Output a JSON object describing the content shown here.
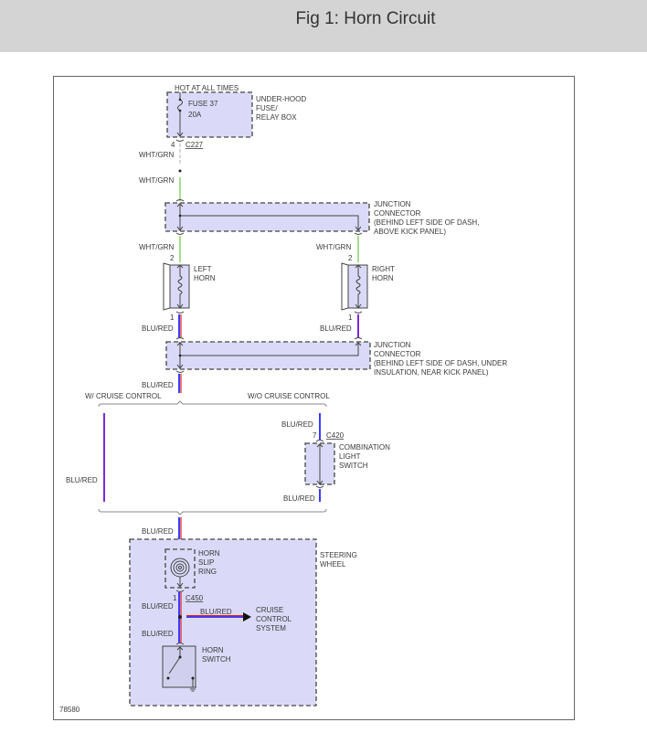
{
  "header": {
    "title": "Fig 1: Horn Circuit"
  },
  "diagram": {
    "hot_label": "HOT AT ALL TIMES",
    "fuse": {
      "name": "FUSE 37",
      "rating": "20A",
      "box_label": [
        "UNDER-HOOD",
        "FUSE/",
        "RELAY BOX"
      ]
    },
    "c227": {
      "pin": "4",
      "connector": "C227"
    },
    "wire_wht_grn": "WHT/GRN",
    "wire_blu_red": "BLU/RED",
    "junction1": [
      "JUNCTION",
      "CONNECTOR",
      "(BEHIND LEFT SIDE OF DASH,",
      "ABOVE KICK PANEL)"
    ],
    "horn_pin_top": "2",
    "horn_pin_bottom": "1",
    "left_horn": [
      "LEFT",
      "HORN"
    ],
    "right_horn": [
      "RIGHT",
      "HORN"
    ],
    "junction2": [
      "JUNCTION",
      "CONNECTOR",
      "(BEHIND LEFT SIDE OF DASH, UNDER",
      "INSULATION, NEAR KICK PANEL)"
    ],
    "with_cruise": "W/ CRUISE CONTROL",
    "without_cruise": "W/O CRUISE CONTROL",
    "c420": {
      "pin": "7",
      "connector": "C420"
    },
    "combination_switch": [
      "COMBINATION",
      "LIGHT",
      "SWITCH"
    ],
    "slip_ring": [
      "HORN",
      "SLIP",
      "RING"
    ],
    "steering_wheel": [
      "STEERING",
      "WHEEL"
    ],
    "c450": {
      "pin": "1",
      "connector": "C450"
    },
    "cruise_system": [
      "CRUISE",
      "CONTROL",
      "SYSTEM"
    ],
    "horn_switch": [
      "HORN",
      "SWITCH"
    ],
    "figure_id": "78580"
  },
  "colors": {
    "header_bg": "#d4d4d4",
    "component_fill": "#dadaf8",
    "wht_grn": "#a8dc8c",
    "blu": "#3a3aff",
    "red": "#e02020"
  }
}
